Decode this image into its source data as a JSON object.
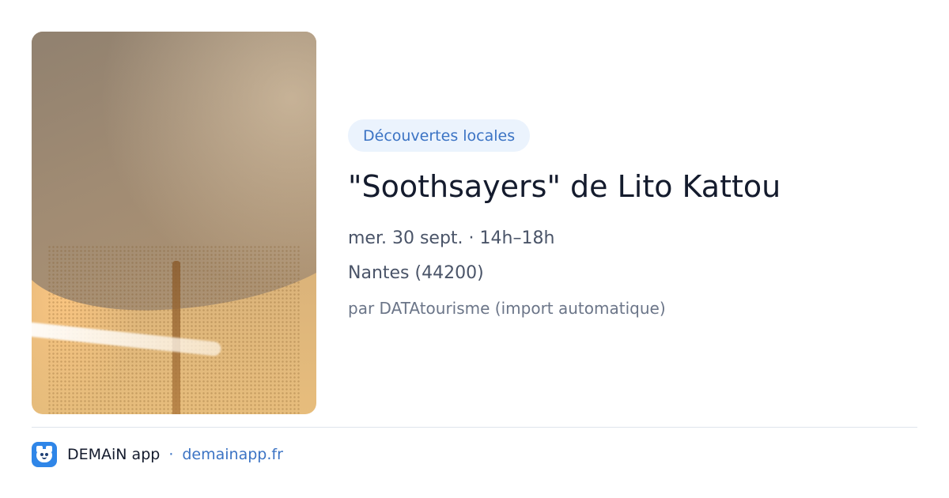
{
  "event": {
    "category": "Découvertes locales",
    "title": "\"Soothsayers\" de Lito Kattou",
    "date_time": "mer. 30 sept. · 14h–18h",
    "location": "Nantes (44200)",
    "source": "par DATAtourisme (import automatique)",
    "image_icon": "event-photo"
  },
  "footer": {
    "app_icon": "demain-app-logo-icon",
    "app_name": "DEMAiN app",
    "separator": "·",
    "site": "demainapp.fr"
  },
  "colors": {
    "accent": "#3b73c4",
    "badge_bg": "#ebf3fd",
    "title": "#141b2d",
    "logo_bg": "#2f86e8"
  }
}
